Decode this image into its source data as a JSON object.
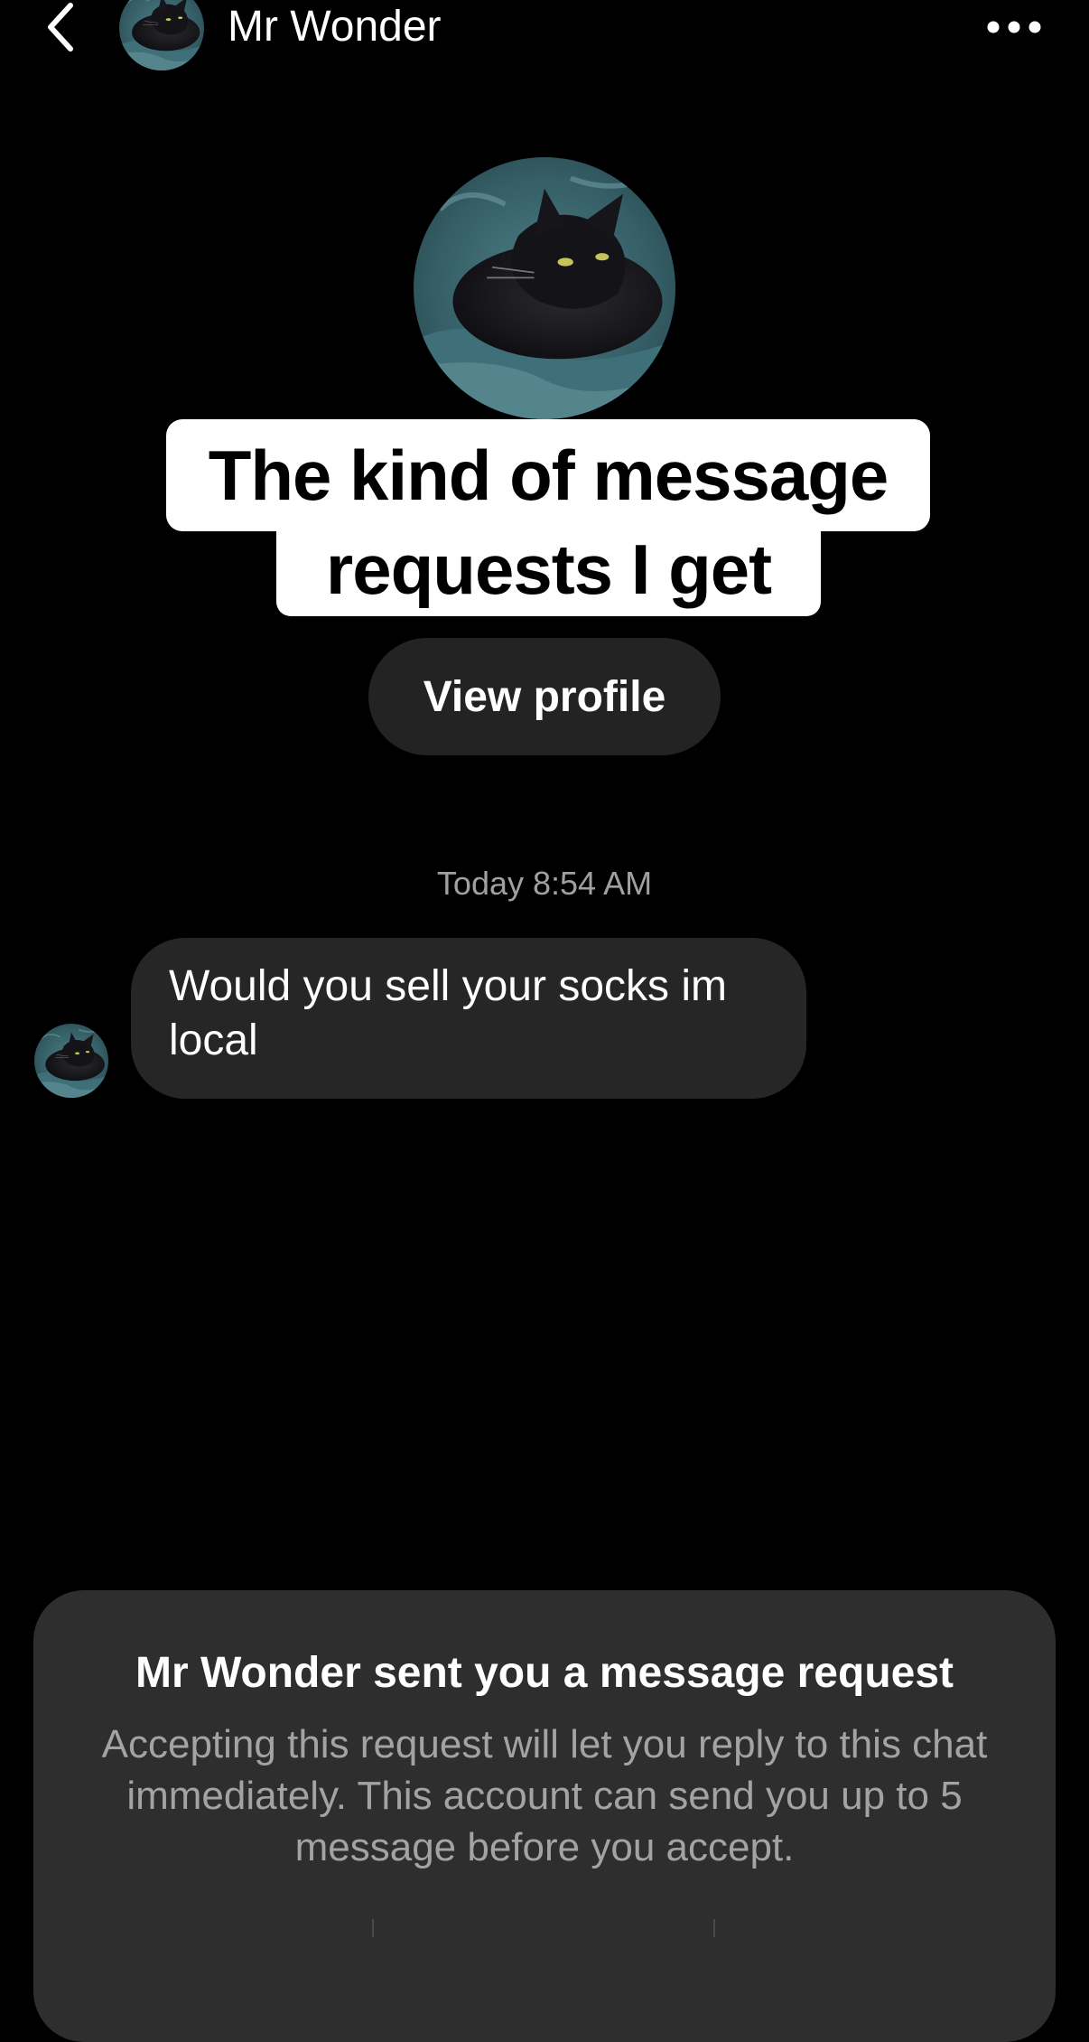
{
  "header": {
    "back_icon": "chevron-left-icon",
    "name": "Mr Wonder",
    "more_icon": "more-horizontal-icon"
  },
  "overlay": {
    "line1": "The kind of message",
    "line2": "requests I get"
  },
  "profile": {
    "view_profile_label": "View profile"
  },
  "chat": {
    "timestamp": "Today 8:54 AM",
    "messages": [
      {
        "sender": "Mr Wonder",
        "text": "Would you sell your socks im local"
      }
    ]
  },
  "request": {
    "title": "Mr Wonder sent you a message request",
    "body": "Accepting this request will let you reply to this chat immediately. This account can send you up to 5 message before you accept."
  },
  "colors": {
    "background": "#000000",
    "bubble": "#262626",
    "panel": "#2e2e2e",
    "secondary_text": "#a3a3a3"
  }
}
